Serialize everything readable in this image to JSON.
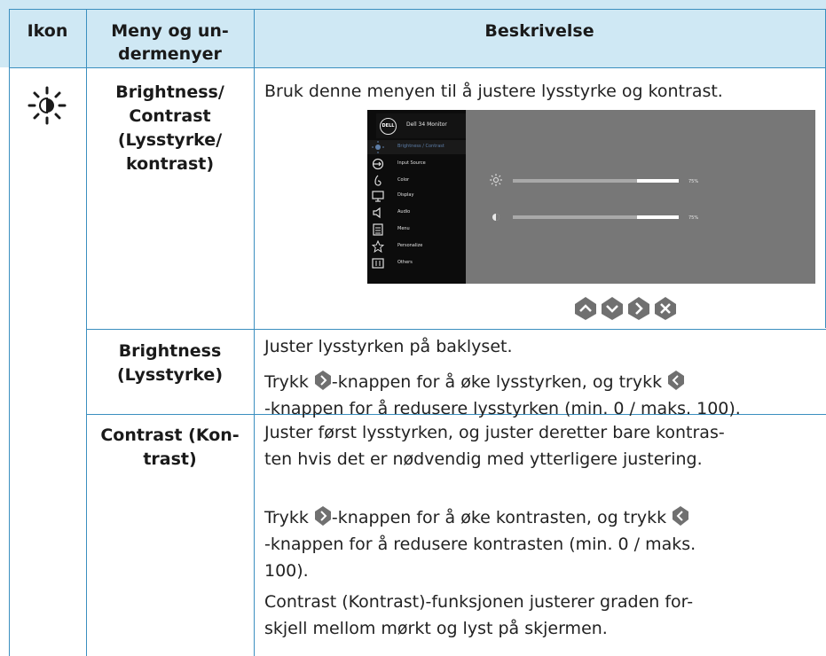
{
  "header": {
    "col_icon": "Ikon",
    "col_menu_line1": "Meny og un-",
    "col_menu_line2": "dermenyer",
    "col_desc": "Beskrivelse"
  },
  "rows": [
    {
      "icon": "brightness-sun-icon",
      "menu_lines": [
        "Brightness/",
        "Contrast",
        "(Lysstyrke/",
        "kontrast)"
      ],
      "desc": "Bruk denne menyen til å justere lysstyrke og kontrast."
    },
    {
      "menu_lines": [
        "Brightness",
        "(Lysstyrke)"
      ],
      "desc_lines": [
        "Juster lysstyrken på baklyset."
      ],
      "trykk_a_before": "Trykk ",
      "trykk_a_mid": "-knappen for å øke lysstyrken, og trykk ",
      "trykk_a_end": "-knappen for å redusere lysstyrken (min. 0 / maks. 100)."
    },
    {
      "menu_lines": [
        "Contrast (Kon-",
        "trast)"
      ],
      "desc_line1": "Juster først lysstyrken, og juster deretter bare kontras-",
      "desc_line2": "ten hvis det er nødvendig med ytterligere justering.",
      "trykk_b_before": "Trykk ",
      "trykk_b_mid": "-knappen for å øke kontrasten, og trykk ",
      "trykk_b_end_line1": "-knappen for å redusere kontrasten (min. 0 / maks.",
      "trykk_b_end_line2": "100).",
      "note_bold": "Contrast (Kontrast)",
      "note_rest": "-funksjonen justerer graden for-",
      "note_line2": "skjell mellom mørkt og lyst på skjermen."
    }
  ],
  "osd": {
    "logo": "DELL",
    "model": "Dell 34 Monitor",
    "menu_items": [
      {
        "label": "Brightness / Contrast",
        "icon": "brightness-icon",
        "selected": true
      },
      {
        "label": "Input Source",
        "icon": "input-source-icon"
      },
      {
        "label": "Color",
        "icon": "color-icon"
      },
      {
        "label": "Display",
        "icon": "display-icon"
      },
      {
        "label": "Audio",
        "icon": "audio-icon"
      },
      {
        "label": "Menu",
        "icon": "menu-icon"
      },
      {
        "label": "Personalize",
        "icon": "star-icon"
      },
      {
        "label": "Others",
        "icon": "others-icon"
      }
    ],
    "brightness_value": "75%",
    "contrast_value": "75%",
    "brightness_level": 0.75,
    "contrast_level": 0.75
  },
  "nav_buttons": [
    "up-icon",
    "down-icon",
    "right-icon",
    "exit-icon"
  ],
  "colors": {
    "header_bg": "#cfe8f4",
    "rule": "#3b8fbf",
    "button": "#707070"
  }
}
